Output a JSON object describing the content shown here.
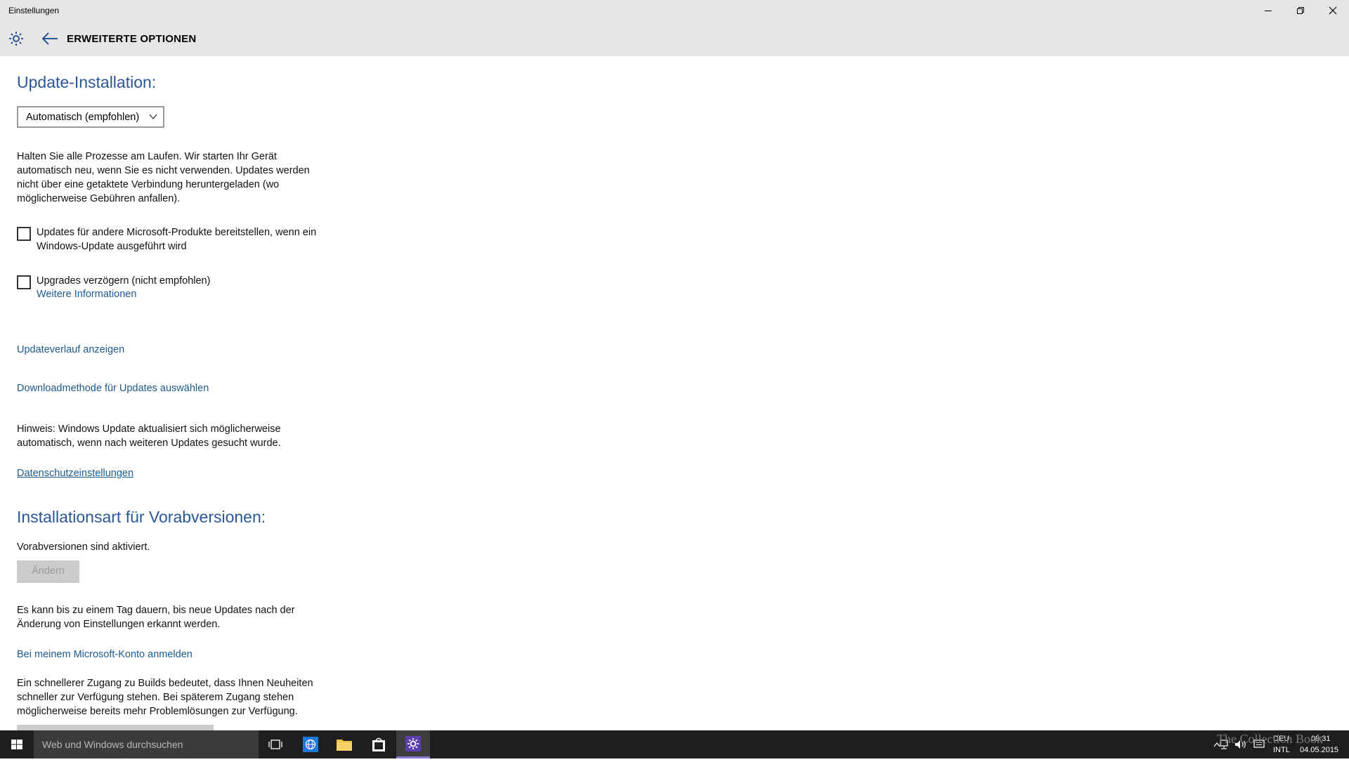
{
  "window": {
    "title": "Einstellungen",
    "minimize": "–",
    "maximize": "❐",
    "close": "✕"
  },
  "header": {
    "title": "ERWEITERTE OPTIONEN"
  },
  "update_install": {
    "heading": "Update-Installation:",
    "dropdown_value": "Automatisch (empfohlen)",
    "desc_lines": [
      "Halten Sie alle Prozesse am Laufen. Wir starten Ihr Gerät",
      "automatisch neu, wenn Sie es nicht verwenden. Updates werden",
      "nicht über eine getaktete Verbindung heruntergeladen (wo",
      "möglicherweise Gebühren anfallen)."
    ]
  },
  "options": {
    "other_products_lines": [
      "Updates für andere Microsoft-Produkte bereitstellen, wenn ein",
      "Windows-Update ausgeführt wird"
    ],
    "defer_upgrades": "Upgrades verzögern (nicht empfohlen)",
    "more_info": "Weitere Informationen"
  },
  "links": {
    "update_history": "Updateverlauf anzeigen",
    "download_method": "Downloadmethode für Updates auswählen",
    "privacy": "Datenschutzeinstellungen",
    "ms_account": "Bei meinem Microsoft-Konto anmelden"
  },
  "notice_lines": [
    "Hinweis: Windows Update aktualisiert sich möglicherweise",
    "automatisch, wenn nach weiteren Updates gesucht wurde."
  ],
  "insider": {
    "heading": "Installationsart für Vorabversionen:",
    "status": "Vorabversionen sind aktiviert.",
    "change_button": "Ändern",
    "delay_lines": [
      "Es kann bis zu einem Tag dauern, bis neue Updates nach der",
      "Änderung von Einstellungen erkannt werden."
    ],
    "speed_lines": [
      "Ein schnellerer Zugang zu Builds bedeutet, dass Ihnen Neuheiten",
      "schneller zur Verfügung stehen. Bei späterem Zugang stehen",
      "möglicherweise bereits mehr Problemlösungen zur Verfügung."
    ]
  },
  "taskbar": {
    "search_placeholder": "Web und Windows durchsuchen",
    "lang_top": "DEU",
    "lang_bottom": "INTL",
    "time": "09:31",
    "date": "04.05.2015",
    "watermark": "The Collection Book"
  },
  "colors": {
    "accent_heading": "#2b5797",
    "link": "#1d5a8e",
    "active_task": "#8a7bd6"
  }
}
